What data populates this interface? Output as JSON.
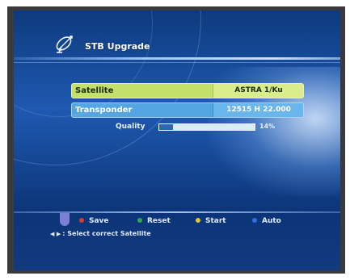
{
  "header": {
    "title": "STB Upgrade",
    "icon": "satellite-icon"
  },
  "fields": {
    "satellite": {
      "label": "Satellite",
      "value": "ASTRA 1/Ku"
    },
    "transponder": {
      "label": "Transponder",
      "value": "12515  H  22.000"
    }
  },
  "quality": {
    "label": "Quality",
    "value_text": "14%",
    "level": 0.14
  },
  "colors": {
    "selected_row": "#c4e06a",
    "row": "#54a6e2",
    "key_red": "#d43a3a",
    "key_green": "#2fa84a",
    "key_yellow": "#e0c43a",
    "key_blue": "#2e6fd8"
  },
  "footer": {
    "keys": [
      {
        "color": "red",
        "label": "Save"
      },
      {
        "color": "green",
        "label": "Reset"
      },
      {
        "color": "yellow",
        "label": "Start"
      },
      {
        "color": "blue",
        "label": "Auto"
      }
    ],
    "hint_arrows": "◀ ▶",
    "hint": ": Select correct Satellite"
  }
}
